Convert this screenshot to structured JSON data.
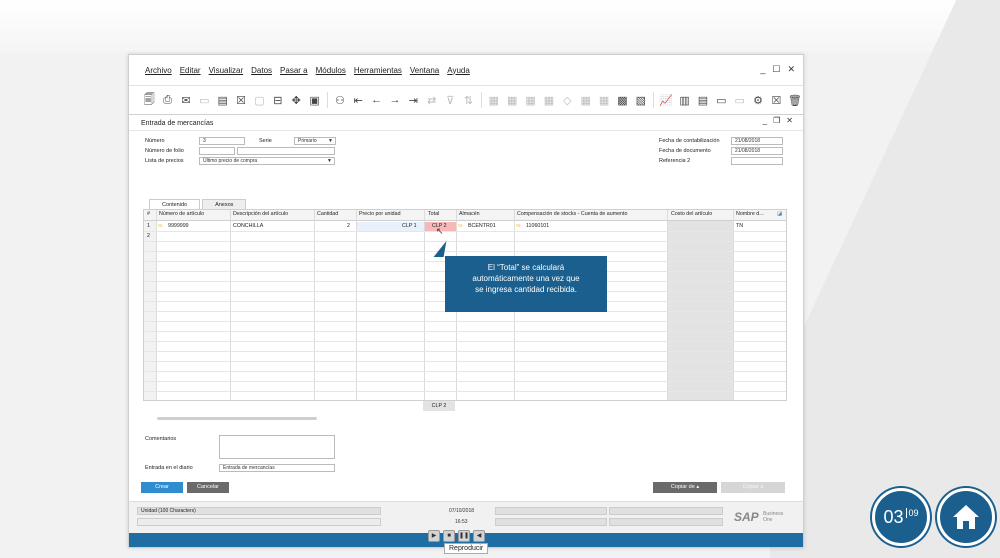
{
  "menu": [
    "Archivo",
    "Editar",
    "Visualizar",
    "Datos",
    "Pasar a",
    "Módulos",
    "Herramientas",
    "Ventana",
    "Ayuda"
  ],
  "document": {
    "title": "Entrada de mercancías",
    "numero_label": "Número",
    "numero_value": "3",
    "serie_label": "Serie",
    "serie_value": "Primario",
    "folio_label": "Número de folio",
    "lista_label": "Lista de precios",
    "lista_value": "Último precio de compra",
    "fecha_cont_label": "Fecha de contabilización",
    "fecha_cont_value": "21/08/2018",
    "fecha_doc_label": "Fecha de documento",
    "fecha_doc_value": "21/08/2018",
    "referencia_label": "Referencia 2"
  },
  "tabs": [
    "Contenido",
    "Anexos"
  ],
  "grid": {
    "headers": [
      "#",
      "Número de artículo",
      "Descripción del artículo",
      "Cantidad",
      "Precio por unidad",
      "Total",
      "Almacén",
      "Compensación de stocks - Cuenta de aumento",
      "Costo del artículo",
      "Nombre d..."
    ],
    "row1": {
      "num": "1",
      "articulo": "9999999",
      "descripcion": "CONCHILLA",
      "cantidad": "2",
      "precio": "CLP 1",
      "total": "CLP 2",
      "almacen": "BCENTR01",
      "cuenta": "11060101",
      "nombre": "TN"
    },
    "row2_num": "2",
    "total_footer": "CLP 2"
  },
  "callout": {
    "line1": "El “Total” se calculará",
    "line2": "automáticamente una vez que",
    "line3": "se ingresa cantidad recibida."
  },
  "form_bottom": {
    "comentarios_label": "Comentarios",
    "diario_label": "Entrada en el diario",
    "diario_value": "Entrada de mercancías"
  },
  "buttons": {
    "crear": "Crear",
    "cancelar": "Cancelar",
    "copiar_de": "Copiar de",
    "copiar_a": "Copiar a"
  },
  "statusbar": {
    "field1": "Unidad (100 Characters)",
    "date": "07/10/2018",
    "time": "16:53",
    "logo": "SAP",
    "logo_sub1": "Business",
    "logo_sub2": "One"
  },
  "player": {
    "tooltip": "Reproducir"
  },
  "counter": {
    "current": "03",
    "total": "09"
  },
  "colors": {
    "accent": "#1a5f8e",
    "button_blue": "#2f8ccf",
    "total_highlight": "#f6b8b8"
  }
}
